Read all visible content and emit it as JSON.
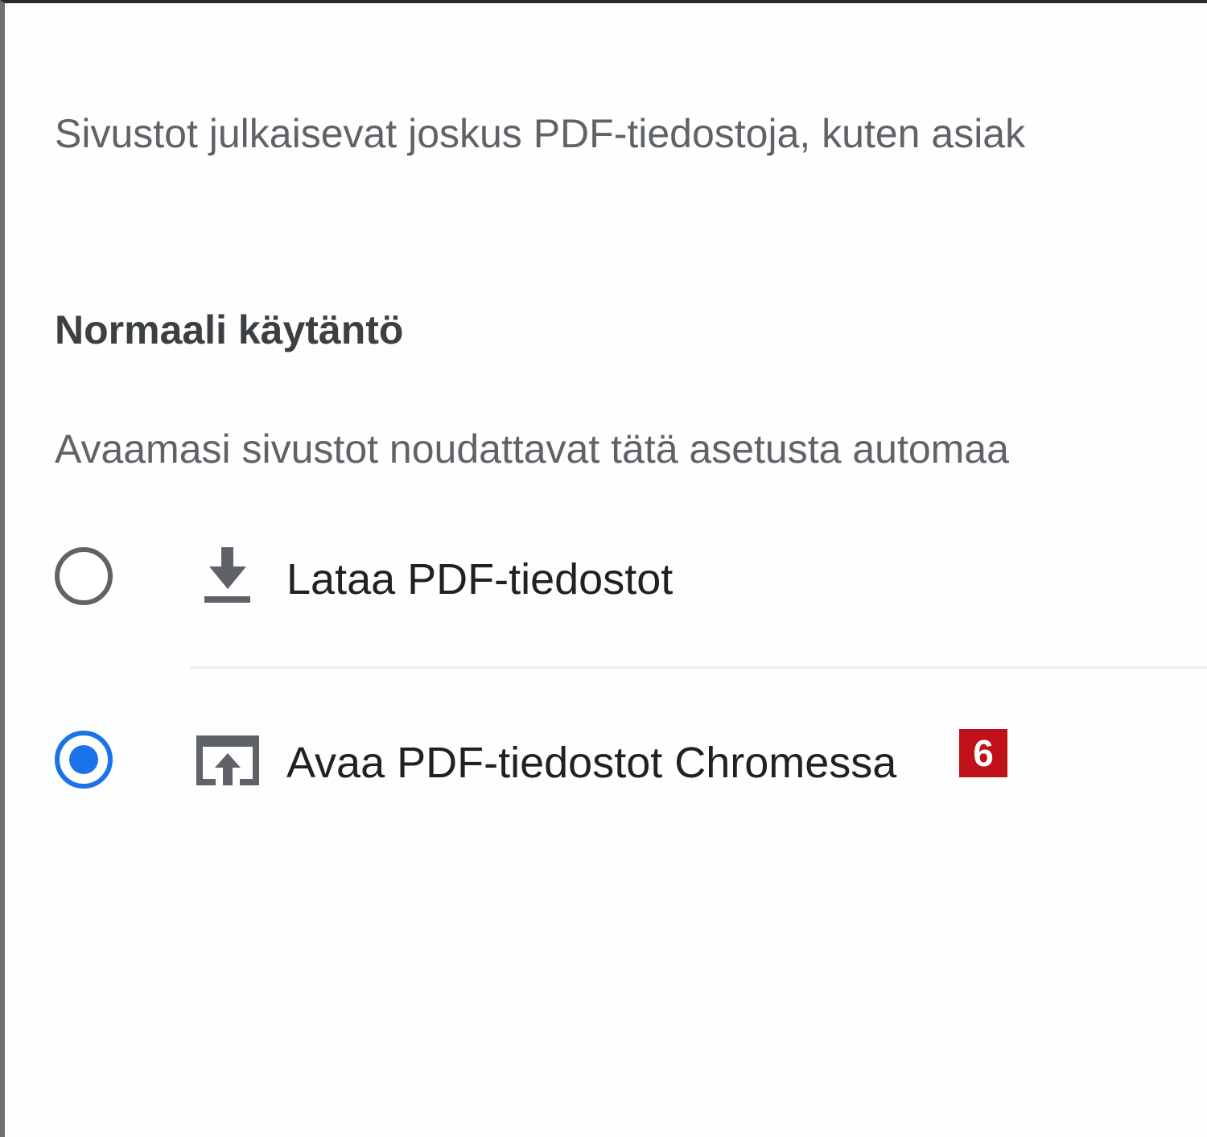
{
  "intro": {
    "text": "Sivustot julkaisevat joskus PDF-tiedostoja, kuten asiak"
  },
  "default_behavior": {
    "heading": "Normaali käytäntö",
    "description": "Avaamasi sivustot noudattavat tätä asetusta automaa",
    "options": [
      {
        "label": "Lataa PDF-tiedostot",
        "icon": "download-icon",
        "selected": false
      },
      {
        "label": "Avaa PDF-tiedostot Chromessa",
        "icon": "open-in-browser-icon",
        "selected": true
      }
    ]
  },
  "annotation": {
    "badge": "6"
  },
  "colors": {
    "accent": "#1a73e8",
    "badge": "#c0101a",
    "icon": "#5f6368",
    "secondary_text": "#5f6368",
    "primary_text": "#202124"
  }
}
